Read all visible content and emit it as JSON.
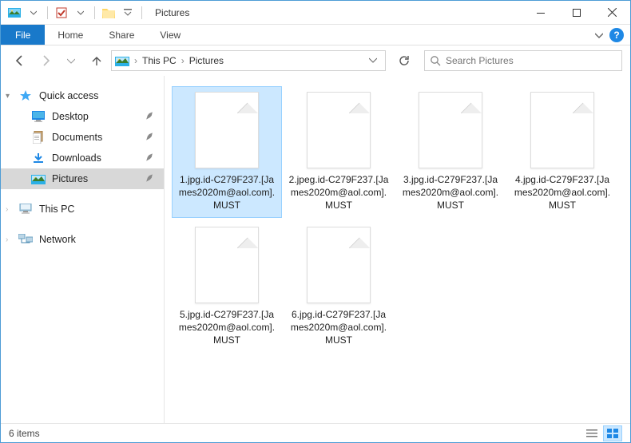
{
  "titlebar": {
    "title": "Pictures"
  },
  "ribbon": {
    "file": "File",
    "tabs": [
      "Home",
      "Share",
      "View"
    ]
  },
  "address": {
    "crumbs": [
      "This PC",
      "Pictures"
    ],
    "search_placeholder": "Search Pictures"
  },
  "sidebar": {
    "quick_access": "Quick access",
    "items": [
      {
        "label": "Desktop",
        "icon": "desktop"
      },
      {
        "label": "Documents",
        "icon": "documents"
      },
      {
        "label": "Downloads",
        "icon": "downloads"
      },
      {
        "label": "Pictures",
        "icon": "pictures",
        "selected": true
      }
    ],
    "this_pc": "This PC",
    "network": "Network"
  },
  "files": [
    "1.jpg.id-C279F237.[James2020m@aol.com].MUST",
    "2.jpeg.id-C279F237.[James2020m@aol.com].MUST",
    "3.jpg.id-C279F237.[James2020m@aol.com].MUST",
    "4.jpg.id-C279F237.[James2020m@aol.com].MUST",
    "5.jpg.id-C279F237.[James2020m@aol.com].MUST",
    "6.jpg.id-C279F237.[James2020m@aol.com].MUST"
  ],
  "status": {
    "count": "6 items"
  }
}
